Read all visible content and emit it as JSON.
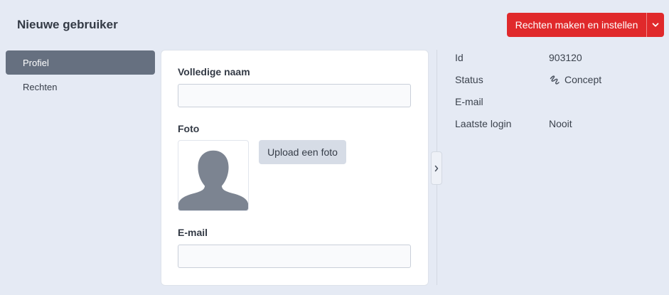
{
  "header": {
    "title": "Nieuwe gebruiker",
    "primary_action": {
      "label": "Rechten maken en instellen",
      "dropdown_icon": "chevron-down-icon"
    }
  },
  "sidebar": {
    "items": [
      {
        "label": "Profiel",
        "active": true
      },
      {
        "label": "Rechten",
        "active": false
      }
    ]
  },
  "form": {
    "full_name": {
      "label": "Volledige naam",
      "value": ""
    },
    "photo": {
      "label": "Foto",
      "placeholder_icon": "avatar-placeholder-icon",
      "upload_label": "Upload een foto"
    },
    "email": {
      "label": "E-mail",
      "value": ""
    }
  },
  "panel_toggle": {
    "icon": "chevron-right-icon"
  },
  "details": {
    "id": {
      "label": "Id",
      "value": "903120"
    },
    "status": {
      "label": "Status",
      "value": "Concept",
      "icon": "draft-icon"
    },
    "email": {
      "label": "E-mail",
      "value": ""
    },
    "last_login": {
      "label": "Laatste login",
      "value": "Nooit"
    }
  },
  "colors": {
    "page_background": "#e5eaf4",
    "primary_button": "#e0292b",
    "active_nav": "#667080",
    "avatar": "#7c8491"
  }
}
